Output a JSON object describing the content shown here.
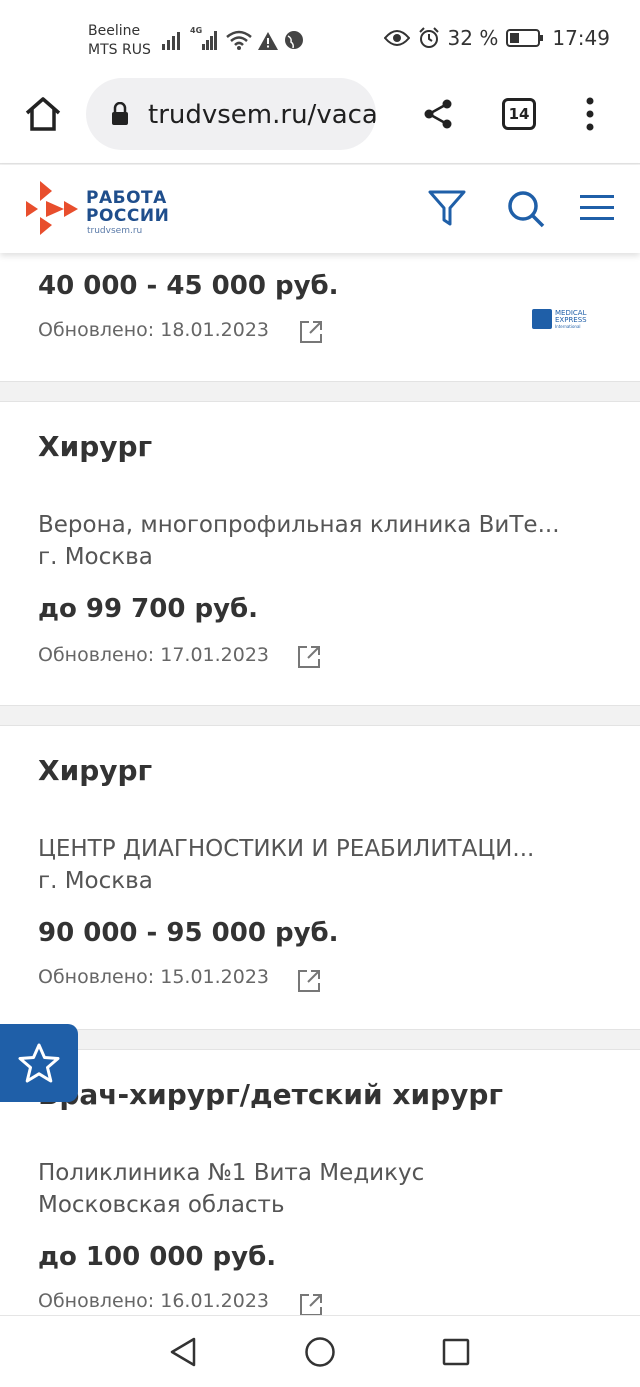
{
  "status": {
    "carrier1": "Beeline",
    "carrier2": "MTS RUS",
    "battery": "32 %",
    "time": "17:49",
    "net_badge": "4G"
  },
  "browser": {
    "url": "trudvsem.ru/vaca",
    "tabs_count": "14"
  },
  "site": {
    "logo_line1": "РАБОТА",
    "logo_line2": "РОССИИ",
    "logo_sub": "trudvsem.ru",
    "brand_color": "#1f4e8c",
    "accent_color": "#e84e2d"
  },
  "partner_logo": {
    "line1": "MEDICAL",
    "line2": "EXPRESS",
    "line3": "International"
  },
  "cards": [
    {
      "salary": "40 000 - 45 000 руб.",
      "updated": "Обновлено: 18.01.2023"
    },
    {
      "title": "Хирург",
      "company": "Верона, многопрофильная клиника ВиТе...",
      "location": "г. Москва",
      "salary": "до 99 700 руб.",
      "updated": "Обновлено: 17.01.2023"
    },
    {
      "title": "Хирург",
      "company": "ЦЕНТР ДИАГНОСТИКИ И РЕАБИЛИТАЦИ...",
      "location": "г. Москва",
      "salary": "90 000 - 95 000 руб.",
      "updated": "Обновлено: 15.01.2023"
    },
    {
      "title": "Врач-хирург/детский хирург",
      "company": "Поликлиника №1 Вита Медикус",
      "location": "Московская область",
      "salary": "до 100 000 руб.",
      "updated": "Обновлено: 16.01.2023"
    }
  ]
}
